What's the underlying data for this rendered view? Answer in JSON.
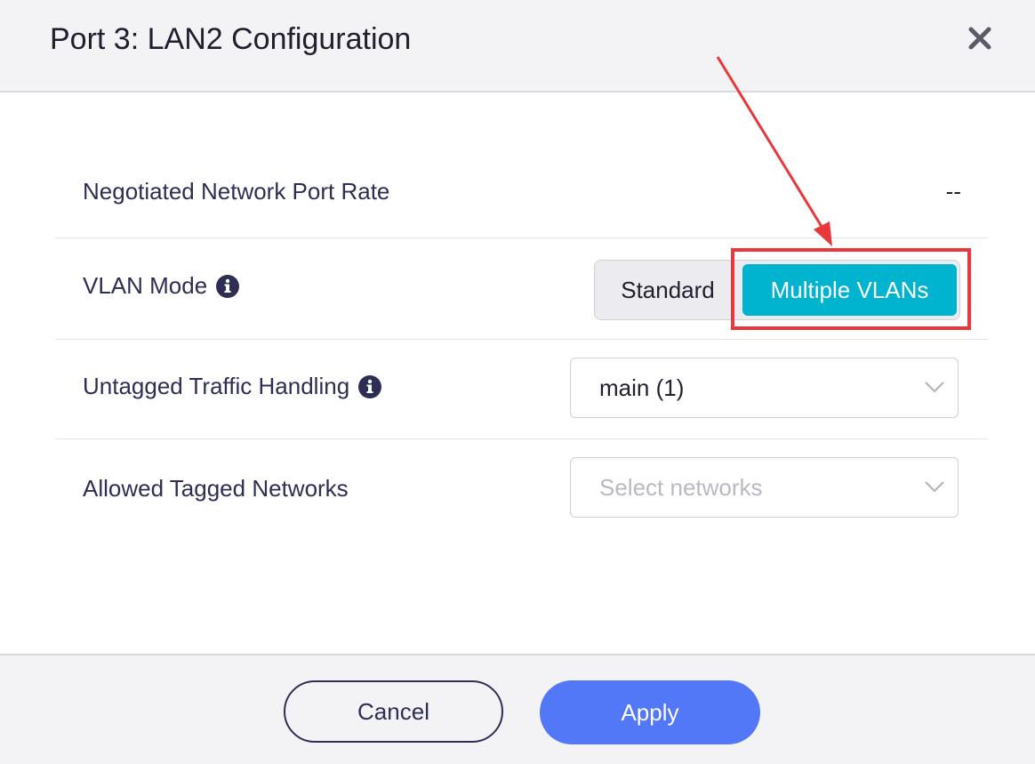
{
  "dialog": {
    "title": "Port 3: LAN2 Configuration",
    "close_icon": "close-icon"
  },
  "rows": {
    "port_rate": {
      "label": "Negotiated Network Port Rate",
      "value": "--"
    },
    "vlan_mode": {
      "label": "VLAN Mode",
      "info_icon": "info-icon",
      "options": [
        "Standard",
        "Multiple VLANs"
      ],
      "selected": "Multiple VLANs",
      "standard_label": "Standard",
      "multiple_label": "Multiple VLANs"
    },
    "untagged": {
      "label": "Untagged Traffic Handling",
      "info_icon": "info-icon",
      "value": "main (1)"
    },
    "tagged": {
      "label": "Allowed Tagged Networks",
      "placeholder": "Select networks"
    }
  },
  "footer": {
    "cancel_label": "Cancel",
    "apply_label": "Apply"
  },
  "colors": {
    "accent_segment": "#00b3cf",
    "apply_button": "#5277f7",
    "annotation_red": "#e8383b",
    "label_text": "#2e2e55"
  }
}
